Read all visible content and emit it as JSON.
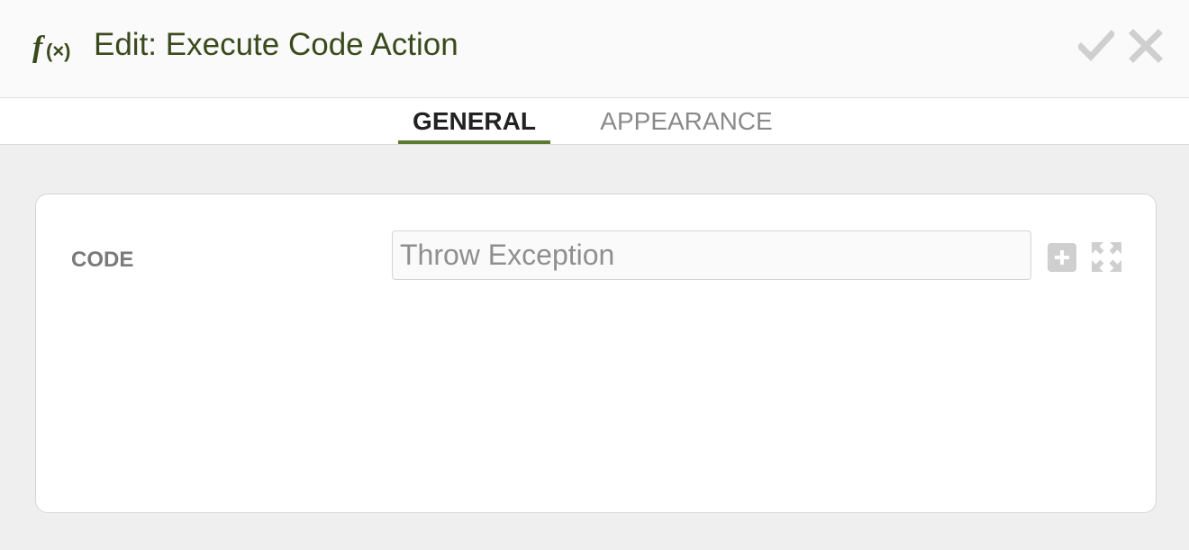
{
  "header": {
    "title": "Edit: Execute Code Action",
    "icon": "function-fx-icon",
    "confirm_icon": "checkmark-icon",
    "close_icon": "close-icon",
    "title_color": "#3a4a1c"
  },
  "tabs": [
    {
      "label": "GENERAL",
      "active": true
    },
    {
      "label": "APPEARANCE",
      "active": false
    }
  ],
  "form": {
    "code_label": "CODE",
    "code_value": "Throw Exception",
    "add_icon": "plus-square-icon",
    "expand_icon": "expand-arrows-icon"
  },
  "colors": {
    "accent": "#5a7a32",
    "icon_gray": "#cfcfcf"
  }
}
